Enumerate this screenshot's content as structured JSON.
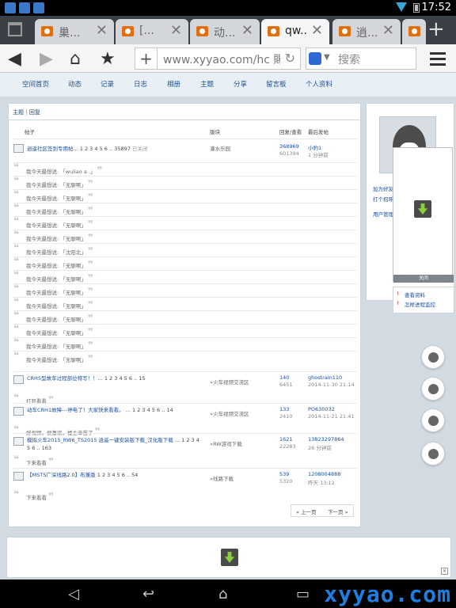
{
  "status": {
    "time": "17:52"
  },
  "tabs": [
    {
      "title": "巢..."
    },
    {
      "title": "[..."
    },
    {
      "title": "动..."
    },
    {
      "title": "qw..."
    },
    {
      "title": "逍..."
    },
    {
      "title": "..."
    }
  ],
  "address": {
    "url": "www.xyyao.com/hc 賜",
    "search_placeholder": "搜索"
  },
  "site_nav": [
    "空间首页",
    "动态",
    "记录",
    "日志",
    "相册",
    "主题",
    "分享",
    "留言板",
    "个人资料"
  ],
  "breadcrumb": {
    "a": "主题",
    "sep": "|",
    "b": "回复"
  },
  "columns": {
    "topic": "帖子",
    "forum": "版块",
    "count": "回复/查看",
    "last": "最后发帖"
  },
  "first_topic": {
    "title": "逍遥社区签到专用帖...",
    "pages": "1 2 3 4 5 6 .. 35897",
    "status": "已关闭",
    "forum": "灌水乐园",
    "replies": "368969",
    "views": "601394",
    "last_user": "小豹1",
    "last_time": "1 分钟前"
  },
  "replies": [
    "我今天最想说: 「wuliao a .」",
    "我今天最想说: 「无聊啊」",
    "我今天最想说: 「无聊啊」",
    "我今天最想说: 「无聊啊」",
    "我今天最想说: 「无聊啊」",
    "我今天最想说: 「无聊啊」",
    "我今天最想说: 「沈阳北」",
    "我今天最想说: 「无聊啊」",
    "我今天最想说: 「无聊啊」",
    "我今天最想说: 「无聊啊」",
    "我今天最想说: 「无聊啊」",
    "我今天最想说: 「无聊啊」",
    "我今天最想说: 「无聊啊」",
    "我今天最想说: 「无聊啊」",
    "我今天最想说: 「无聊啊」"
  ],
  "topics": [
    {
      "title": "CRH5型故车过程部位特写！！...",
      "pages": "1 2 3 4 5 6 .. 15",
      "forum": "»火车视频交流区",
      "replies": "140",
      "views": "6451",
      "last_user": "ghostrain110",
      "last_time": "2014-11-30 21:14",
      "reply": "打开看看"
    },
    {
      "title": "动车CRH1故障---停电了！大家快来看看。",
      "pages": "... 1 2 3 4 5 6 .. 14",
      "forum": "»火车视频交流区",
      "replies": "133",
      "views": "2410",
      "last_user": "PO630032",
      "last_time": "2014-11-21 21:41",
      "reply": "好视频，很喜欢，楼主辛苦了"
    },
    {
      "title": "模拟火车2015_RW6_TS2015 逍遥一键安装版下载_汉化版下载",
      "pages": "... 1 2 3 4 5 6 .. 163",
      "forum": "»RW游戏下载",
      "replies": "1621",
      "views": "22283",
      "last_user": "13823297864",
      "last_time": "26 分钟前",
      "reply": "下来看看"
    },
    {
      "title": "【MSTS广深线路2.0】布兼版",
      "pages": "1 2 3 4 5 6 .. 54",
      "forum": "»线路下载",
      "replies": "539",
      "views": "5320",
      "last_user": "1208004888",
      "last_time": "昨天 13:12",
      "reply": "下来看看"
    }
  ],
  "pager": {
    "prev": "« 上一页",
    "next": "下一页 »"
  },
  "sidebar": {
    "link1": "加为好友",
    "link2": "打个招呼",
    "link3": "用户管理",
    "close": "关闭",
    "extra1": "查看资料",
    "extra2": "怎样进程监控"
  },
  "watermark": "xyyao.com"
}
